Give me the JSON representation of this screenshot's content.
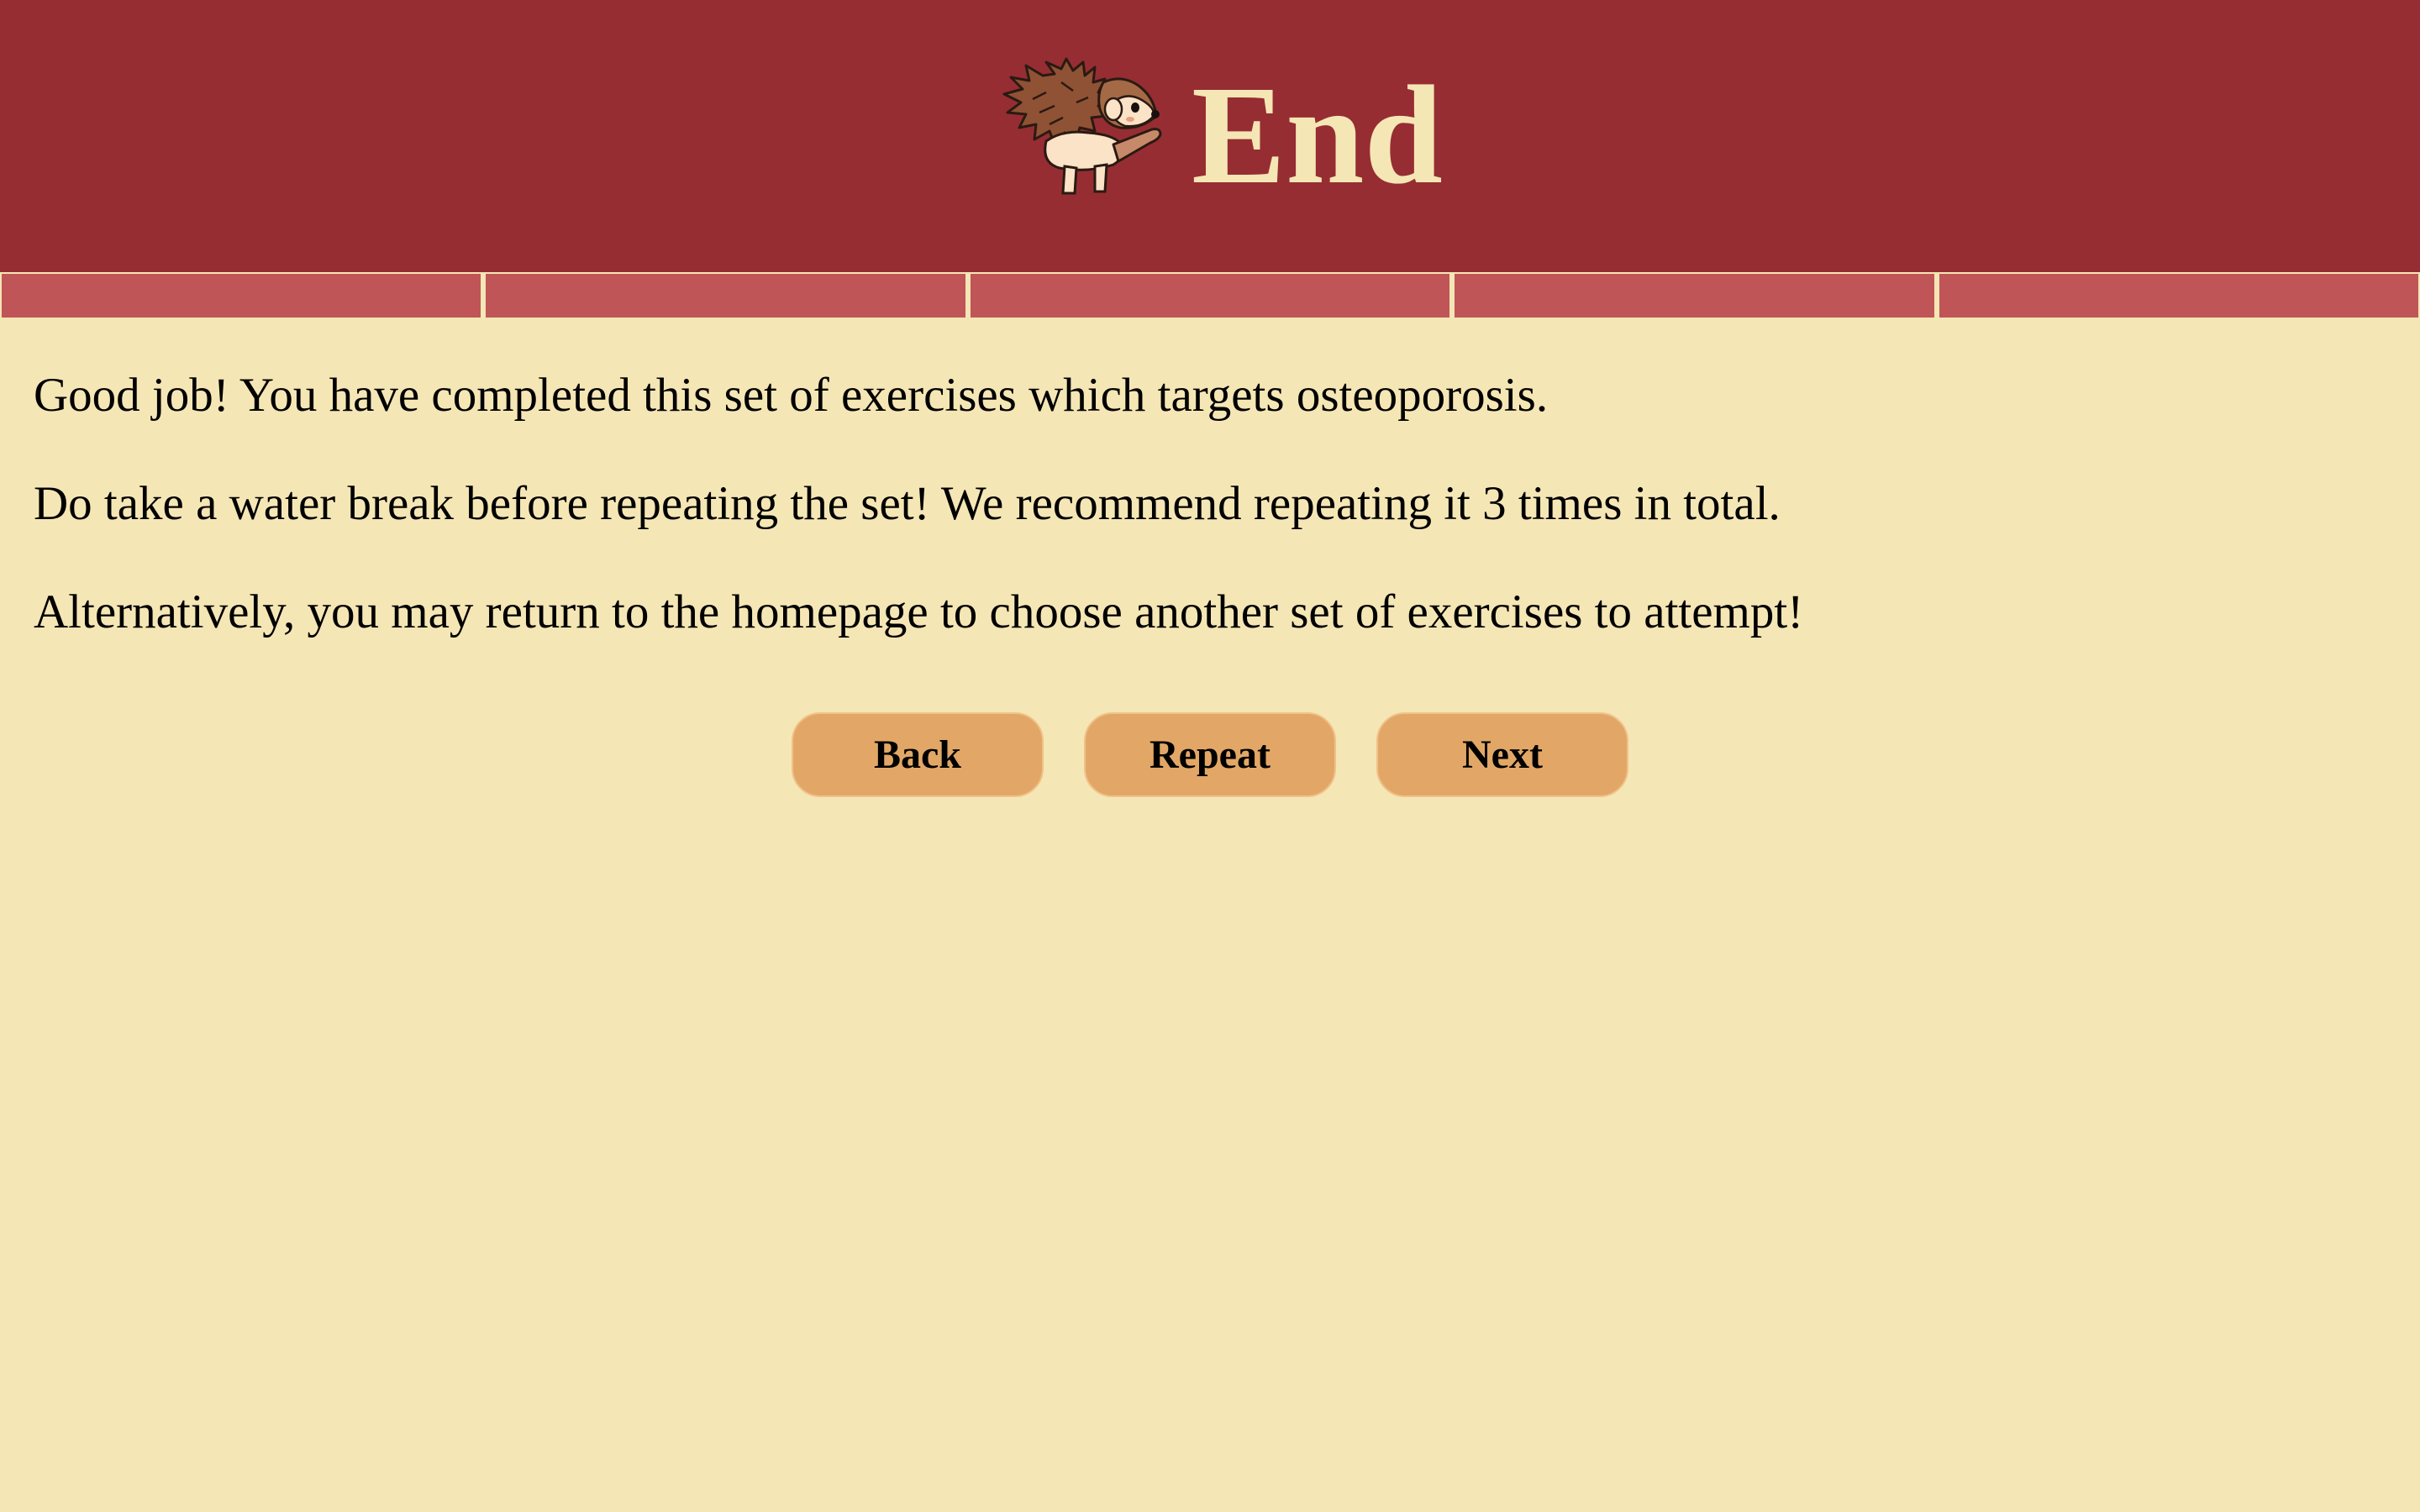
{
  "header": {
    "title": "End",
    "mascot_icon": "hedgehog-icon",
    "background_color": "#962d32",
    "title_color": "#f5e6b5"
  },
  "progress": {
    "segments": 5,
    "completed": 5,
    "segment_color": "#bf5557"
  },
  "content": {
    "paragraphs": [
      "Good job! You have completed this set of exercises which targets osteoporosis.",
      "Do take a water break before repeating the set! We recommend repeating it 3 times in total.",
      "Alternatively, you may return to the homepage to choose another set of exercises to attempt!"
    ]
  },
  "buttons": {
    "back_label": "Back",
    "repeat_label": "Repeat",
    "next_label": "Next",
    "button_color": "#e2a766"
  },
  "page": {
    "background_color": "#f5e6b5"
  }
}
